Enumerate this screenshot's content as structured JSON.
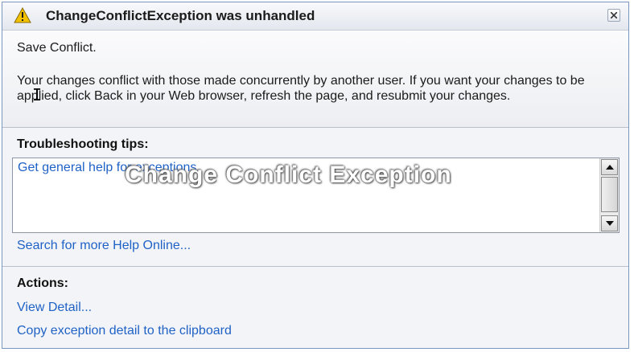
{
  "dialog": {
    "title": "ChangeConflictException was unhandled",
    "icons": {
      "title": "warning-triangle-icon",
      "close": "close-icon",
      "scroll_up": "scroll-up-arrow-icon",
      "scroll_down": "scroll-down-arrow-icon"
    },
    "message": {
      "heading": "Save Conflict.",
      "body": "Your changes conflict with those made concurrently by another user. If you want your changes to be applied, click Back in your Web browser, refresh the page, and resubmit your changes."
    },
    "troubleshooting": {
      "heading": "Troubleshooting tips:",
      "tips": [
        "Get general help for exceptions."
      ],
      "search_link": "Search for more Help Online..."
    },
    "actions": {
      "heading": "Actions:",
      "items": [
        "View Detail...",
        "Copy exception detail to the clipboard"
      ]
    },
    "watermark": "Change Conflict Exception"
  },
  "colors": {
    "link": "#1f62c6",
    "warning": "#f2c200",
    "border": "#7a96c0"
  }
}
